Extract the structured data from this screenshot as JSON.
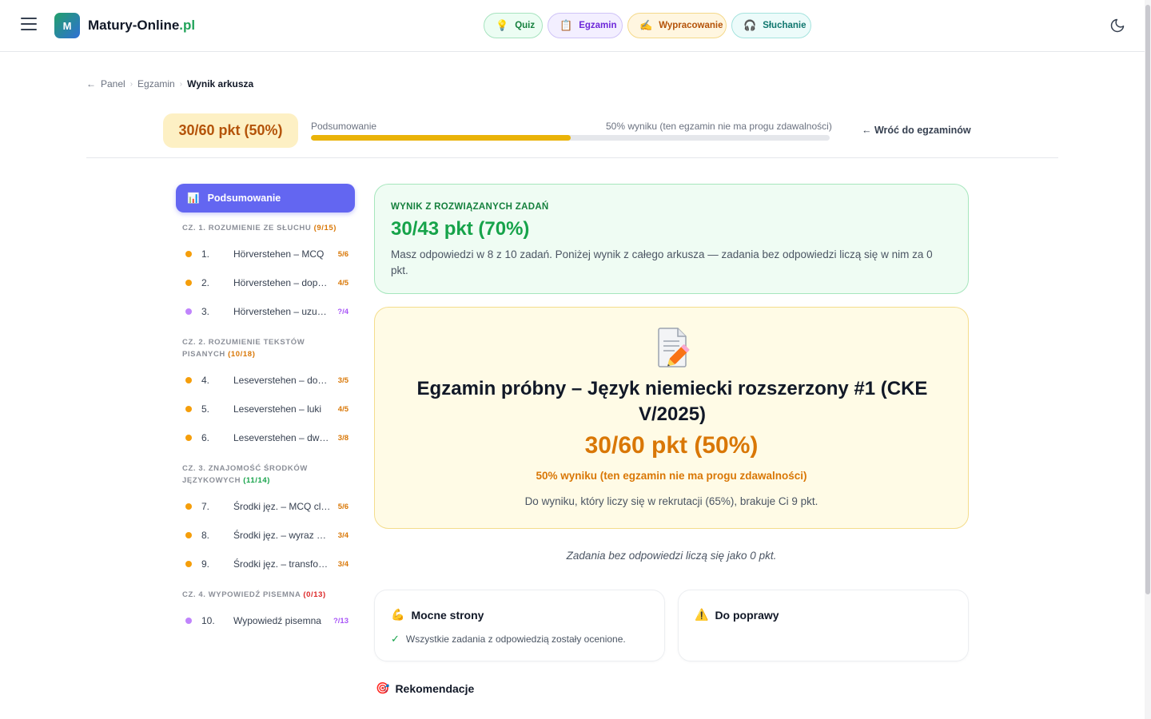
{
  "header": {
    "logo_letter": "M",
    "brand_name": "Matury-Online",
    "brand_tld": ".pl",
    "nav": [
      {
        "label": "Quiz",
        "icon": "lightbulb-icon"
      },
      {
        "label": "Egzamin",
        "icon": "clipboard-icon"
      },
      {
        "label": "Wypracowanie",
        "icon": "writing-hand-icon"
      },
      {
        "label": "Słuchanie",
        "icon": "headphones-icon"
      }
    ]
  },
  "breadcrumb": {
    "back_arrow": "←",
    "items": [
      "Panel",
      "Egzamin"
    ],
    "current": "Wynik arkusza"
  },
  "summary_bar": {
    "score": "30/60 pkt (50%)",
    "label": "Podsumowanie",
    "right_text": "50% wyniku (ten egzamin nie ma progu zdawalności)",
    "progress_percent": 50,
    "back_label": "← Wróć do egzaminów"
  },
  "sidebar": {
    "summary_button": "Podsumowanie",
    "sections": [
      {
        "title": "CZ. 1. ROZUMIENIE ZE SŁUCHU",
        "count": "(9/15)",
        "tasks": [
          {
            "num": "1.",
            "title": "Hörverstehen – MCQ",
            "pts": "5/6",
            "status": "graded"
          },
          {
            "num": "2.",
            "title": "Hörverstehen – dopasowanie",
            "pts": "4/5",
            "status": "graded"
          },
          {
            "num": "3.",
            "title": "Hörverstehen – uzupełnianie",
            "pts": "?/4",
            "status": "pending"
          }
        ]
      },
      {
        "title": "CZ. 2. ROZUMIENIE TEKSTÓW PISANYCH",
        "count": "(10/18)",
        "tasks": [
          {
            "num": "4.",
            "title": "Leseverstehen – dopasowanie",
            "pts": "3/5",
            "status": "graded"
          },
          {
            "num": "5.",
            "title": "Leseverstehen – luki",
            "pts": "4/5",
            "status": "graded"
          },
          {
            "num": "6.",
            "title": "Leseverstehen – dwa teksty",
            "pts": "3/8",
            "status": "graded"
          }
        ]
      },
      {
        "title": "CZ. 3. ZNAJOMOŚĆ ŚRODKÓW JĘZYKOWYCH",
        "count": "(11/14)",
        "tasks": [
          {
            "num": "7.",
            "title": "Środki jęz. – MCQ cloze",
            "pts": "5/6",
            "status": "graded"
          },
          {
            "num": "8.",
            "title": "Środki jęz. – wyraz w luce",
            "pts": "3/4",
            "status": "graded"
          },
          {
            "num": "9.",
            "title": "Środki jęz. – transformacje",
            "pts": "3/4",
            "status": "graded"
          }
        ]
      },
      {
        "title": "CZ. 4. WYPOWIEDŹ PISEMNA",
        "count": "(0/13)",
        "tasks": [
          {
            "num": "10.",
            "title": "Wypowiedź pisemna",
            "pts": "?/13",
            "status": "pending"
          }
        ]
      }
    ]
  },
  "result_card": {
    "heading": "WYNIK Z ROZWIĄZANYCH ZADAŃ",
    "score": "30/43 pkt (70%)",
    "text": "Masz odpowiedzi w 8 z 10 zadań. Poniżej wynik z całego arkusza — zadania bez odpowiedzi liczą się w nim za 0 pkt."
  },
  "exam_card": {
    "icon": "document-pencil-icon",
    "title": "Egzamin próbny – Język niemiecki rozszerzony #1 (CKE V/2025)",
    "score": "30/60 pkt (50%)",
    "subtitle": "50% wyniku (ten egzamin nie ma progu zdawalności)",
    "note": "Do wyniku, który liczy się w rekrutacji (65%), brakuje Ci 9 pkt."
  },
  "unanswered_note": "Zadania bez odpowiedzi liczą się jako 0 pkt.",
  "strengths": {
    "title": "Mocne strony",
    "items": [
      "Wszystkie zadania z odpowiedzią zostały ocenione."
    ]
  },
  "improvements": {
    "title": "Do poprawy"
  },
  "recommendations": {
    "title": "Rekomendacje"
  },
  "colors": {
    "accent": "#6366f1",
    "success": "#16a34a",
    "warning": "#d97706",
    "pending": "#a855f7"
  }
}
